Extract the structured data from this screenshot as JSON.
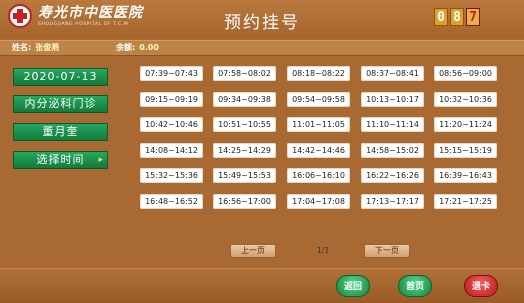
{
  "header": {
    "hospital_name": "寿光市中医医院",
    "hospital_en": "SHOUGUANG HOSPITAL OF T.C.M",
    "title": "预约挂号",
    "counter": [
      "0",
      "8",
      "7"
    ]
  },
  "info": {
    "name_label": "姓名:",
    "name_value": "张俊燕",
    "balance_label": "余额:",
    "balance_value": "0.00"
  },
  "left_panel": {
    "date": "2020-07-13",
    "department": "内分泌科门诊",
    "doctor": "董月奎",
    "select_time": "选择时间"
  },
  "time_slots": [
    [
      "07:39~07:43",
      "07:58~08:02",
      "08:18~08:22",
      "08:37~08:41",
      "08:56~09:00"
    ],
    [
      "09:15~09:19",
      "09:34~09:38",
      "09:54~09:58",
      "10:13~10:17",
      "10:32~10:36"
    ],
    [
      "10:42~10:46",
      "10:51~10:55",
      "11:01~11:05",
      "11:10~11:14",
      "11:20~11:24"
    ],
    [
      "14:08~14:12",
      "14:25~14:29",
      "14:42~14:46",
      "14:58~15:02",
      "15:15~15:19"
    ],
    [
      "15:32~15:36",
      "15:49~15:53",
      "16:06~16:10",
      "16:22~16:26",
      "16:39~16:43"
    ],
    [
      "16:48~16:52",
      "16:56~17:00",
      "17:04~17:08",
      "17:13~17:17",
      "17:21~17:25"
    ]
  ],
  "pager": {
    "prev": "上一页",
    "page": "1/1",
    "next": "下一页"
  },
  "bottom": {
    "back": "返回",
    "home": "首页",
    "exit_card": "退卡"
  },
  "colors": {
    "background": "#a86a32",
    "green_button": "#1a8c45",
    "red_button": "#c82020"
  }
}
